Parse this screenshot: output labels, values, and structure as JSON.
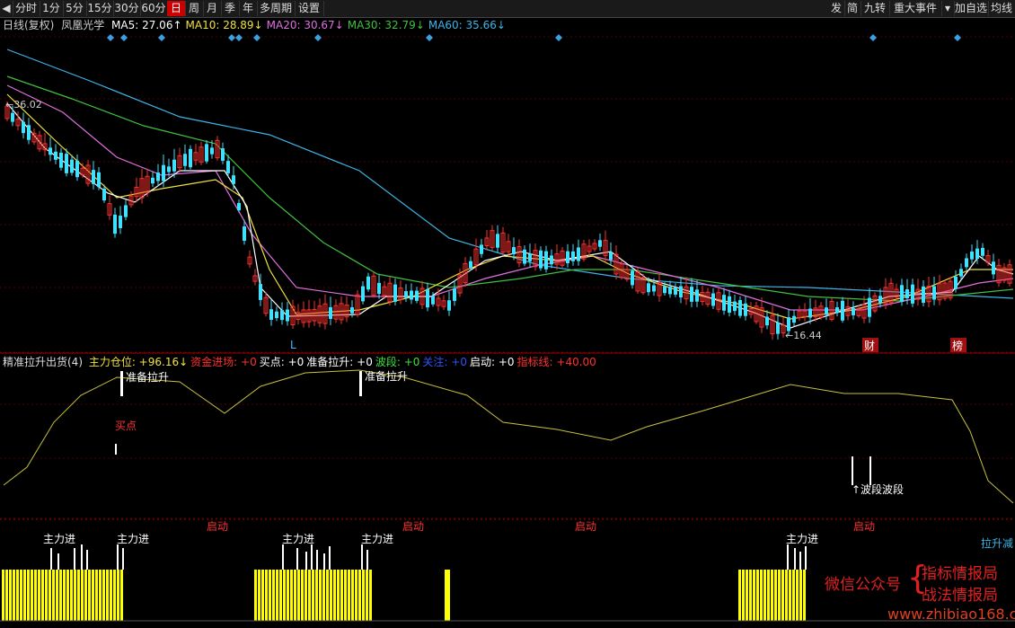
{
  "toolbar": {
    "left": [
      "◀",
      "分时",
      "1分",
      "5分",
      "15分",
      "30分",
      "60分",
      "日",
      "周",
      "月",
      "季",
      "年",
      "多周期",
      "设置"
    ],
    "active": "日",
    "right": [
      "发",
      "简",
      "九转",
      "重大事件",
      "▾",
      "加自选",
      "均线"
    ]
  },
  "ma": {
    "period": "日线(复权)",
    "stock": "凤凰光学",
    "items": [
      {
        "label": "MA5: 27.06↑",
        "color": "#ffffff"
      },
      {
        "label": "MA10: 28.89↓",
        "color": "#f0e040"
      },
      {
        "label": "MA20: 30.67↓",
        "color": "#e070e0"
      },
      {
        "label": "MA30: 32.79↓",
        "color": "#40c040"
      },
      {
        "label": "MA60: 35.66↓",
        "color": "#3cb4e8"
      }
    ]
  },
  "price": {
    "high_label": "36.02",
    "low_label": "16.44",
    "markers": [
      "L",
      "财",
      "榜"
    ]
  },
  "indicator": {
    "name": "精准拉升出货(4)",
    "items": [
      {
        "label": "主力仓位: +96.16↓",
        "color": "#f0e040"
      },
      {
        "label": "资金进场: +0",
        "color": "#ff3030"
      },
      {
        "label": "买点: +0",
        "color": "#ffffff"
      },
      {
        "label": "准备拉升: +0",
        "color": "#ffffff"
      },
      {
        "label": "波段: +0",
        "color": "#40e040"
      },
      {
        "label": "关注: +0",
        "color": "#3050ff"
      },
      {
        "label": "启动: +0",
        "color": "#ffffff"
      },
      {
        "label": "指标线: +40.00",
        "color": "#ff3030"
      }
    ],
    "labels": {
      "prep1": "准备拉升",
      "prep2": "准备拉升",
      "buy": "买点",
      "wave": "波段波段",
      "start": "启动",
      "main_in": "主力进",
      "lift_reduce": "拉升减"
    }
  },
  "watermark": {
    "line1": "微信公众号",
    "line2a": "指标情报局",
    "line2b": "战法情报局",
    "site": "www.zhibiao168.com"
  },
  "colors": {
    "up": "#ff3030",
    "down": "#40e0ff",
    "yellow": "#ffff00"
  }
}
